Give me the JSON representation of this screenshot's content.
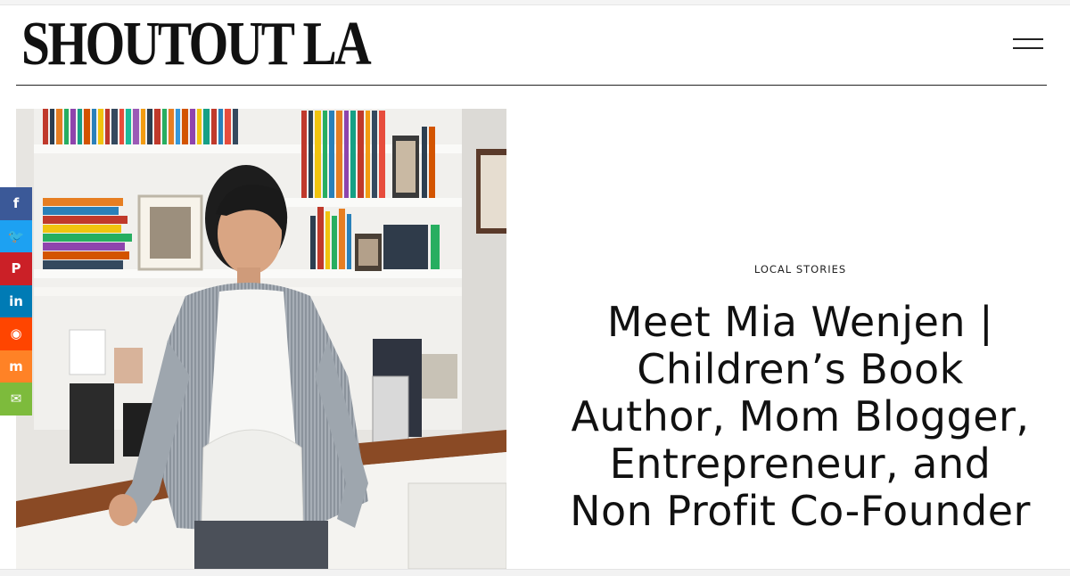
{
  "header": {
    "logo": "SHOUTOUT LA",
    "menu_icon": "hamburger-menu-icon"
  },
  "hero": {
    "image_subject": "portrait of woman in striped blazer leaning on desk in front of bookshelf"
  },
  "share_bar": [
    {
      "name": "facebook",
      "glyph": "f",
      "color": "#3b5998"
    },
    {
      "name": "twitter",
      "glyph": "t",
      "color": "#1da1f2"
    },
    {
      "name": "pinterest",
      "glyph": "P",
      "color": "#cb2027"
    },
    {
      "name": "linkedin",
      "glyph": "in",
      "color": "#007bb5"
    },
    {
      "name": "reddit",
      "glyph": "r",
      "color": "#ff4500"
    },
    {
      "name": "mix",
      "glyph": "m",
      "color": "#ff8226"
    },
    {
      "name": "email",
      "glyph": "✉",
      "color": "#7dbb3c"
    }
  ],
  "article": {
    "category": "LOCAL STORIES",
    "title_lines": [
      "Meet Mia Wenjen |",
      "Children’s Book",
      "Author, Mom Blogger,",
      "Entrepreneur, and",
      "Non Profit Co-Founder"
    ]
  }
}
